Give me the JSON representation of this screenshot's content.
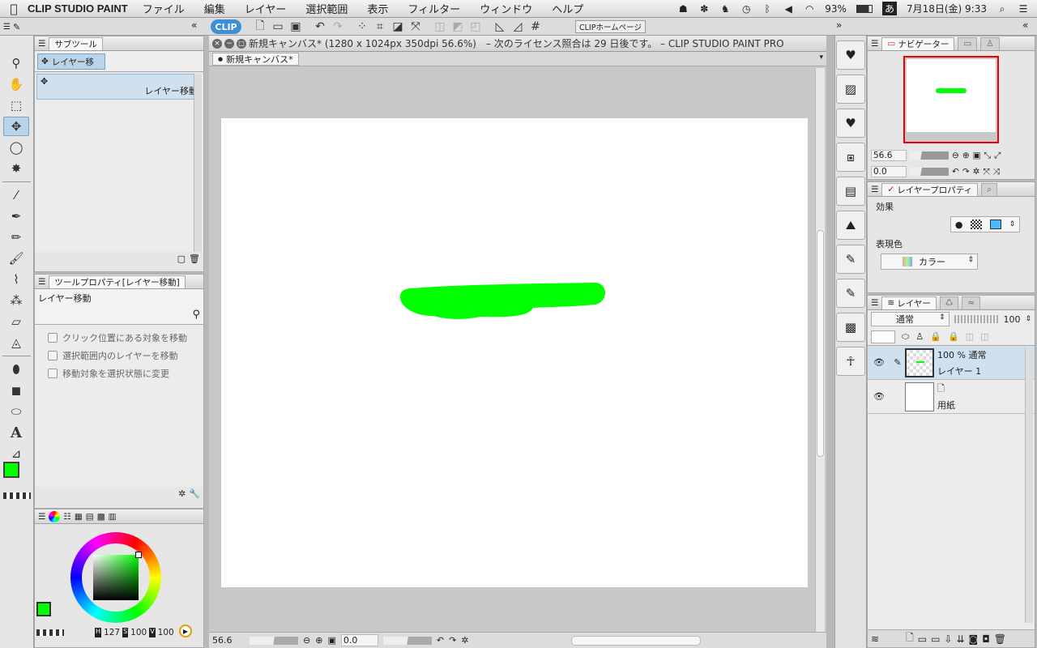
{
  "menubar": {
    "app_name": "CLIP STUDIO PAINT",
    "items": [
      "ファイル",
      "編集",
      "レイヤー",
      "選択範囲",
      "表示",
      "フィルター",
      "ウィンドウ",
      "ヘルプ"
    ],
    "battery": "93%",
    "ime": "あ",
    "clock": "7月18日(金) 9:33"
  },
  "toolbar": {
    "logo": "CLIP",
    "home_button": "CLIPホームページ"
  },
  "subtool_panel": {
    "tab_label": "サブツール",
    "group_label": "レイヤー移",
    "selected_item": "レイヤー移動"
  },
  "tool_property": {
    "tab_label": "ツールプロパティ[レイヤー移動]",
    "title": "レイヤー移動",
    "options": [
      "クリック位置にある対象を移動",
      "選択範囲内のレイヤーを移動",
      "移動対象を選択状態に変更"
    ]
  },
  "color_panel": {
    "values": [
      "127",
      "100",
      "100"
    ],
    "main_color": "#00ff00",
    "sub_color": "#ffffff"
  },
  "document": {
    "title": "新規キャンバス* (1280 x 1024px 350dpi 56.6%)　– 次のライセンス照合は 29 日後です。 – CLIP STUDIO PAINT PRO",
    "tab": "新規キャンバス*",
    "zoom": "56.6",
    "rotation": "0.0",
    "stroke_color": "#00ff00"
  },
  "navigator": {
    "tab_label": "ナビゲーター",
    "zoom": "56.6",
    "rotation": "0.0"
  },
  "layer_property": {
    "tab_label": "レイヤープロパティ",
    "effect_label": "効果",
    "expression_label": "表現色",
    "expression_value": "カラー"
  },
  "layers": {
    "tab_label": "レイヤー",
    "blend_mode": "通常",
    "opacity": "100",
    "items": [
      {
        "meta": "100 % 通常",
        "name": "レイヤー 1"
      },
      {
        "meta": "",
        "name": "用紙"
      }
    ]
  }
}
